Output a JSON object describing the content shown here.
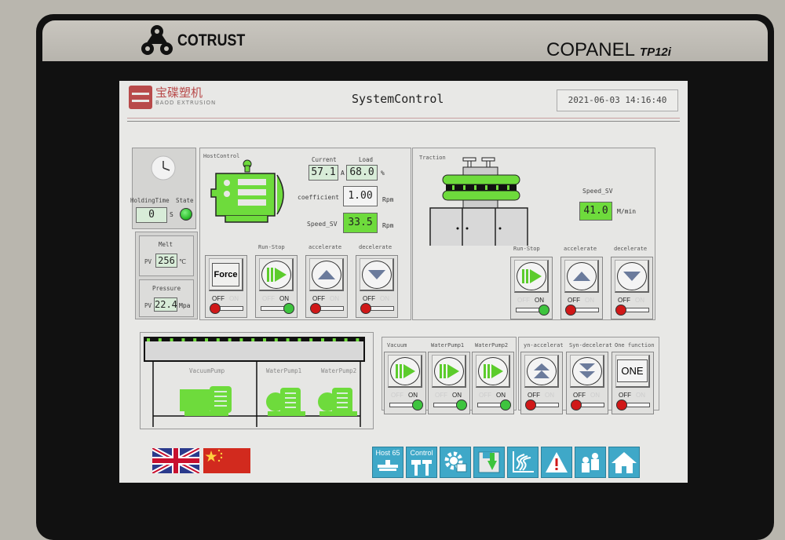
{
  "device": {
    "brand": "COTRUST",
    "model": "COPANEL",
    "model_suffix": "TP12i"
  },
  "header": {
    "logo_cn": "宝碟塑机",
    "logo_en": "BAOD EXTRUSION",
    "title": "SystemControl",
    "datetime": "2021-06-03 14:16:40"
  },
  "holding": {
    "icon": "clock-icon",
    "time_label": "HoldingTime",
    "state_label": "State",
    "time_value": "0",
    "time_unit": "S",
    "state_color": "#2fbf2f"
  },
  "melt": {
    "title": "Melt",
    "pv_label": "PV",
    "value": "256",
    "unit": "℃"
  },
  "pressure": {
    "title": "Pressure",
    "pv_label": "PV",
    "value": "22.4",
    "unit": "Mpa"
  },
  "host": {
    "title": "HostControl",
    "current_label": "Current",
    "current_value": "57.1",
    "current_unit": "A",
    "load_label": "Load",
    "load_value": "68.0",
    "load_unit": "%",
    "coefficient_label": "coefficient",
    "coefficient_value": "1.00",
    "coefficient_unit": "Rpm",
    "speed_label": "Speed_SV",
    "speed_value": "33.5",
    "speed_unit": "Rpm",
    "buttons": [
      {
        "label": "",
        "face": "Force",
        "off": "OFF",
        "on": "ON",
        "state": "off"
      },
      {
        "label": "Run-Stop",
        "face": "play",
        "off": "OFF",
        "on": "ON",
        "state": "on"
      },
      {
        "label": "accelerate",
        "face": "up",
        "off": "OFF",
        "on": "ON",
        "state": "off"
      },
      {
        "label": "decelerate",
        "face": "down",
        "off": "OFF",
        "on": "ON",
        "state": "off"
      }
    ]
  },
  "traction": {
    "title": "Traction",
    "speed_label": "Speed_SV",
    "speed_value": "41.0",
    "speed_unit": "M/min",
    "buttons": [
      {
        "label": "Run-Stop",
        "face": "play",
        "off": "OFF",
        "on": "ON",
        "state": "on"
      },
      {
        "label": "accelerate",
        "face": "up",
        "off": "OFF",
        "on": "ON",
        "state": "off"
      },
      {
        "label": "decelerate",
        "face": "down",
        "off": "OFF",
        "on": "ON",
        "state": "off"
      }
    ]
  },
  "pumps": {
    "vacuum_label": "VacuumPump",
    "water1_label": "WaterPump1",
    "water2_label": "WaterPump2"
  },
  "pump_controls": {
    "buttons": [
      {
        "label": "Vacuum",
        "face": "play",
        "off": "OFF",
        "on": "ON",
        "state": "on"
      },
      {
        "label": "WaterPump1",
        "face": "play",
        "off": "OFF",
        "on": "ON",
        "state": "on"
      },
      {
        "label": "WaterPump2",
        "face": "play",
        "off": "OFF",
        "on": "ON",
        "state": "on"
      }
    ]
  },
  "sync_controls": {
    "buttons": [
      {
        "label": "yn-accelerat",
        "face": "dup",
        "off": "OFF",
        "on": "ON",
        "state": "off"
      },
      {
        "label": "Syn-decelerat",
        "face": "ddown",
        "off": "OFF",
        "on": "ON",
        "state": "off"
      },
      {
        "label": "One function",
        "face": "ONE",
        "off": "OFF",
        "on": "ON",
        "state": "off"
      }
    ]
  },
  "languages": [
    {
      "name": "English",
      "icon": "uk-flag-icon"
    },
    {
      "name": "Chinese",
      "icon": "china-flag-icon"
    }
  ],
  "toolbar": [
    {
      "label": "Host 65",
      "icon": "extruder-icon"
    },
    {
      "label": "Control",
      "icon": "tools-icon"
    },
    {
      "label": "",
      "icon": "settings-gear-icon"
    },
    {
      "label": "",
      "icon": "save-download-icon"
    },
    {
      "label": "",
      "icon": "trend-chart-icon"
    },
    {
      "label": "",
      "icon": "alarm-warning-icon"
    },
    {
      "label": "",
      "icon": "users-icon"
    },
    {
      "label": "",
      "icon": "home-icon"
    }
  ],
  "colors": {
    "accent_green": "#6edb3c",
    "toolbar_blue": "#3fa8c8",
    "off_red": "#d01818",
    "on_green": "#3ec43e"
  }
}
